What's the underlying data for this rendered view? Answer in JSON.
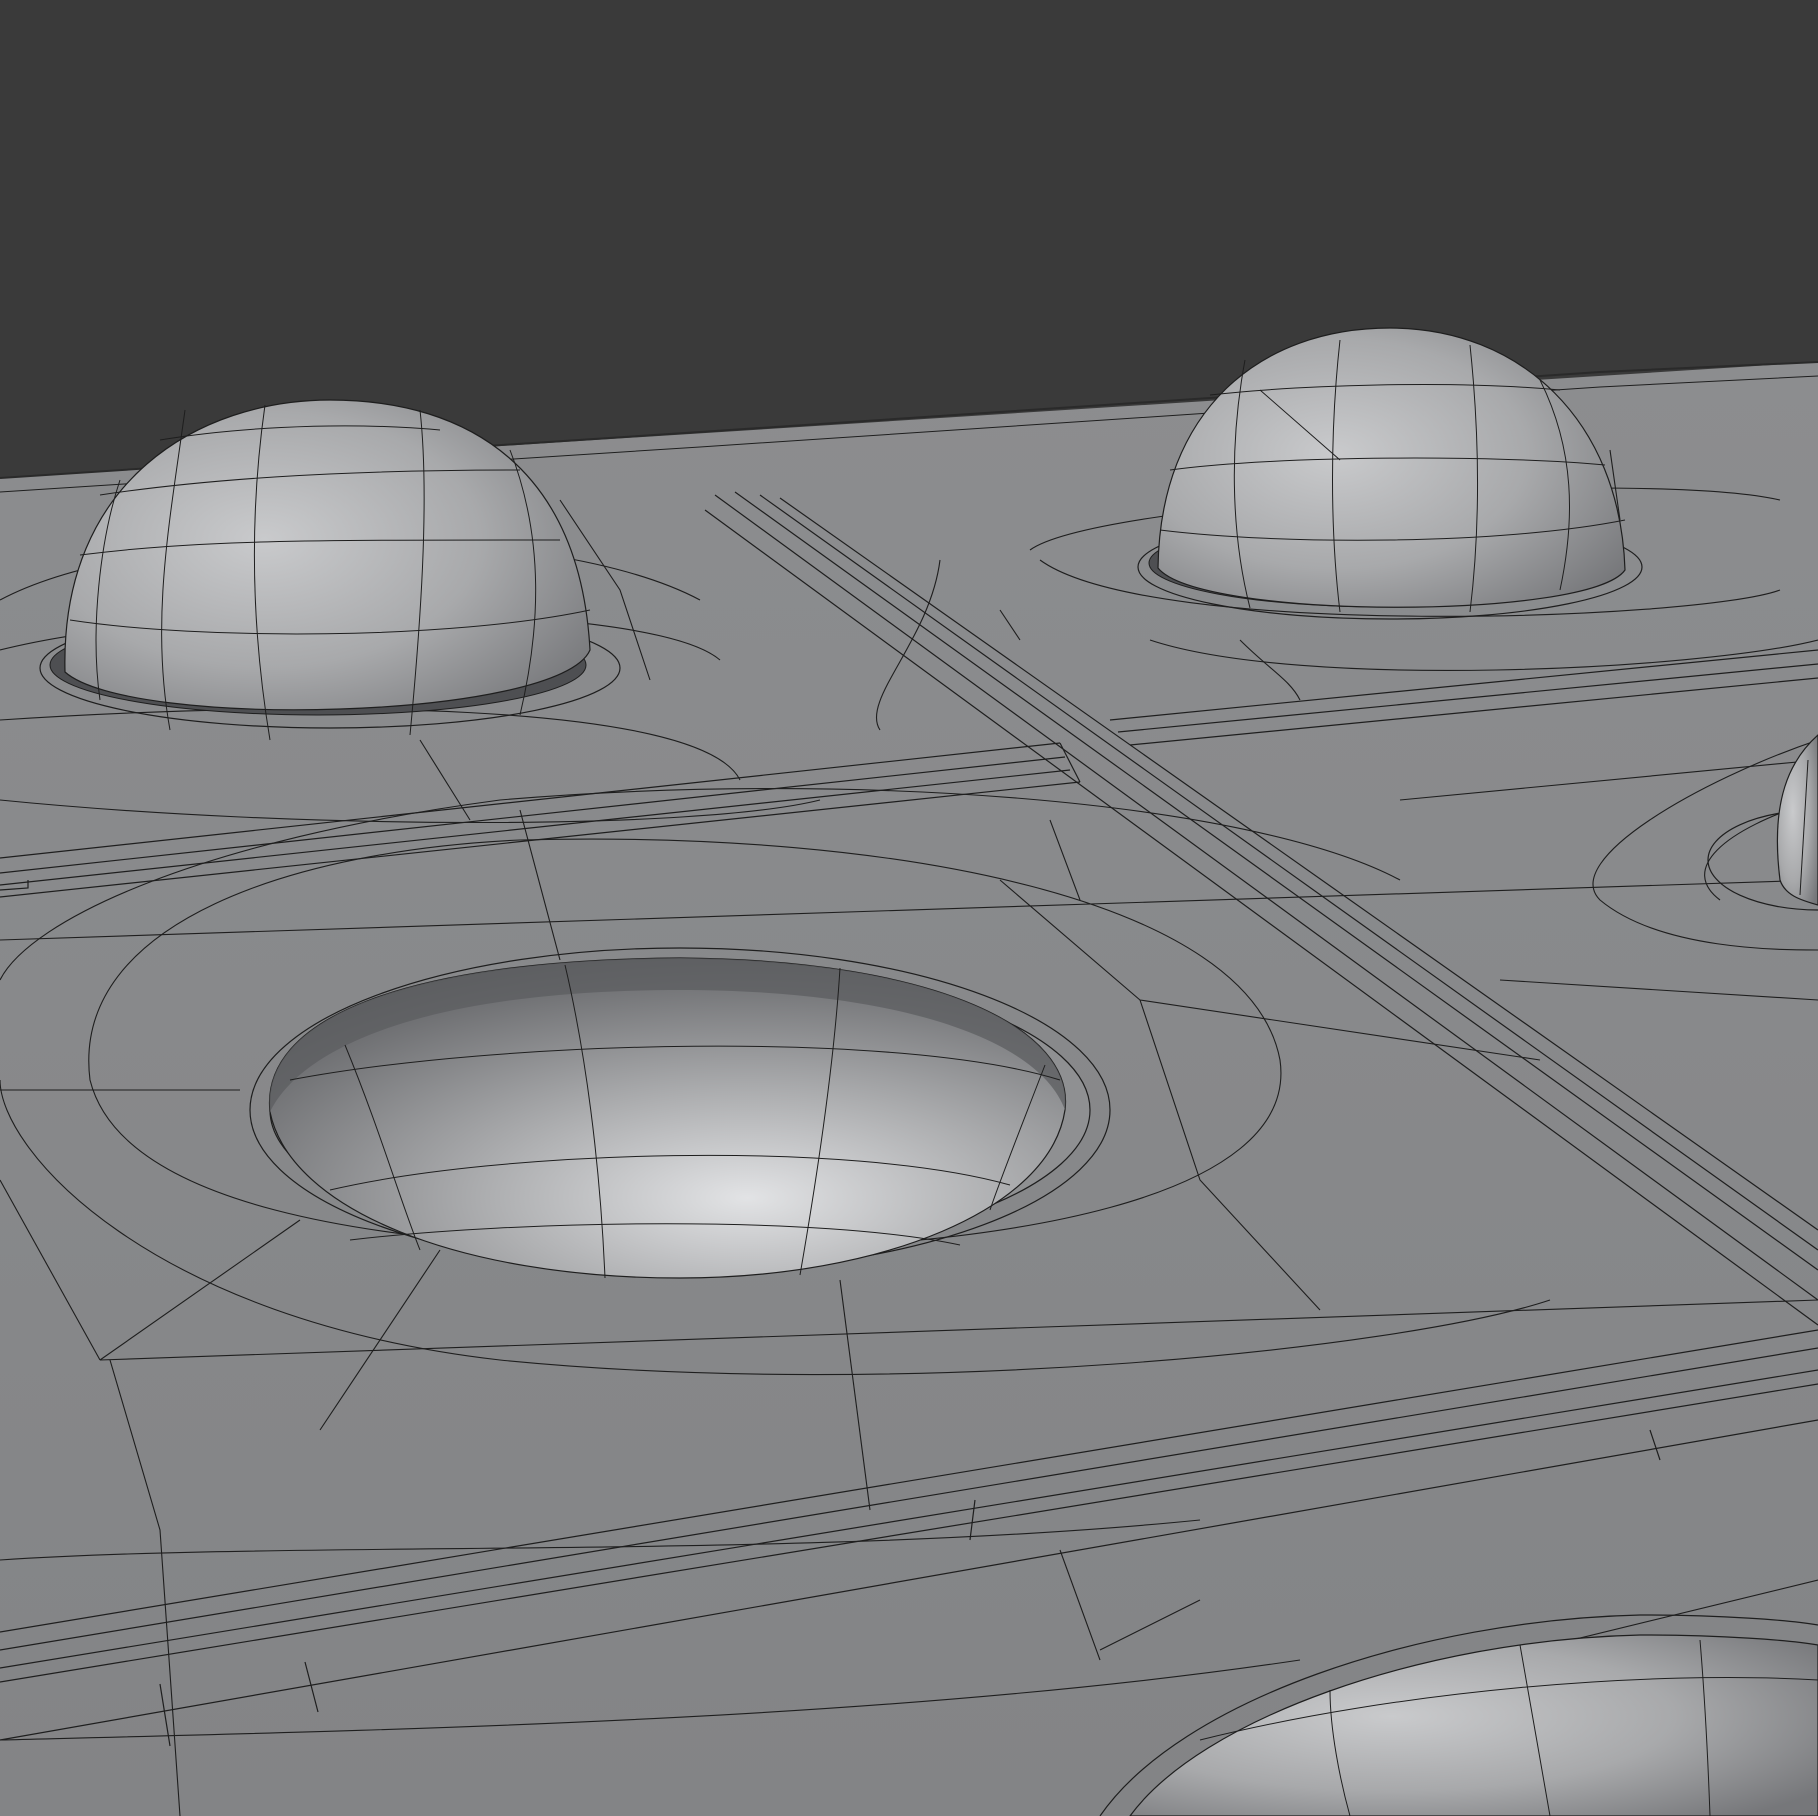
{
  "viewport": {
    "background_color": "#3a3a3a",
    "surface_color": "#8a8b8d",
    "wire_color": "#1e1e1e",
    "objects": [
      {
        "name": "dome-back-left",
        "kind": "bump"
      },
      {
        "name": "dome-back-right",
        "kind": "bump"
      },
      {
        "name": "dome-right-edge",
        "kind": "bump"
      },
      {
        "name": "dimple-center",
        "kind": "dimple"
      },
      {
        "name": "dome-front",
        "kind": "bump"
      }
    ]
  }
}
